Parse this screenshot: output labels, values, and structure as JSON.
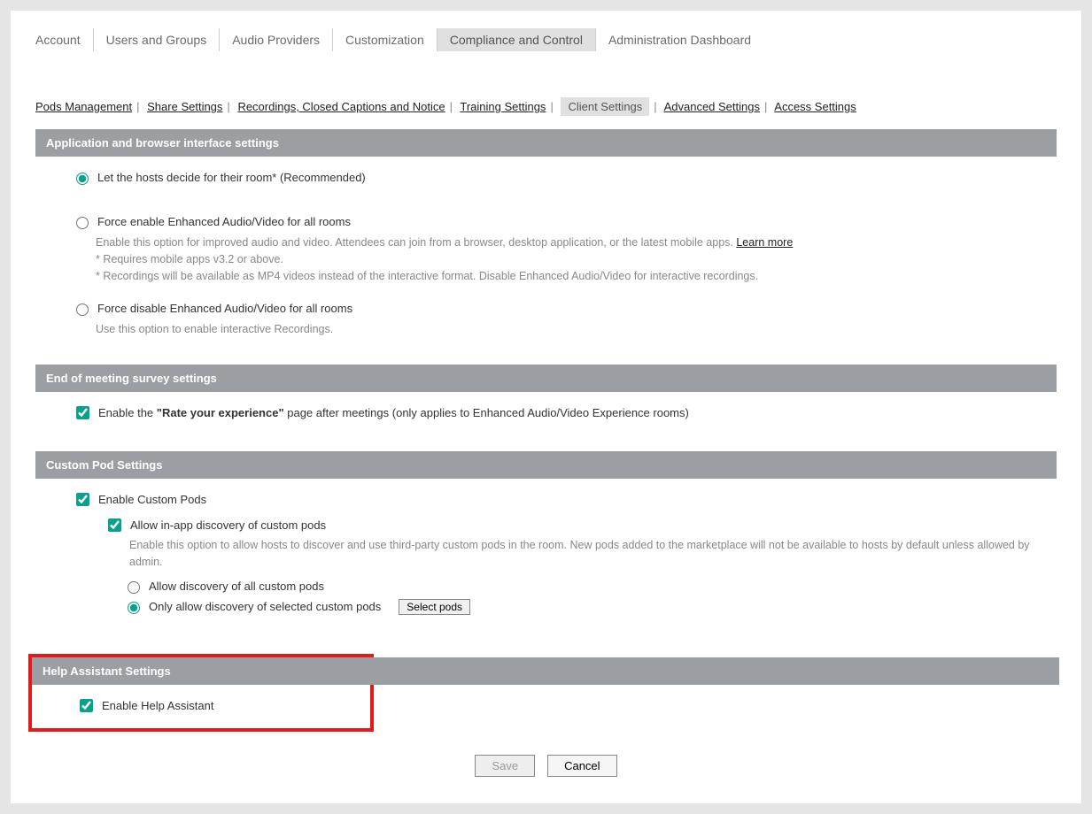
{
  "topNav": {
    "account": "Account",
    "usersGroups": "Users and Groups",
    "audioProviders": "Audio Providers",
    "customization": "Customization",
    "compliance": "Compliance and Control",
    "adminDashboard": "Administration Dashboard"
  },
  "subNav": {
    "pods": "Pods Management",
    "share": "Share Settings",
    "recordings": "Recordings, Closed Captions and Notice",
    "training": "Training Settings",
    "client": "Client Settings",
    "advanced": "Advanced Settings",
    "access": "Access Settings"
  },
  "sections": {
    "app": {
      "header": "Application and browser interface settings",
      "opt1": "Let the hosts decide for their room* (Recommended)",
      "opt2": "Force enable Enhanced Audio/Video for all rooms",
      "opt2desc1": "Enable this option for improved audio and video. Attendees can join from a browser, desktop application, or the latest mobile apps. ",
      "learnMore": "Learn more",
      "opt2desc2": "* Requires mobile apps v3.2 or above.",
      "opt2desc3": "* Recordings will be available as MP4 videos instead of the interactive format. Disable Enhanced Audio/Video for interactive recordings.",
      "opt3": "Force disable Enhanced Audio/Video for all rooms",
      "opt3desc": "Use this option to enable interactive Recordings."
    },
    "survey": {
      "header": "End of meeting survey settings",
      "pre": "Enable the ",
      "bold": "\"Rate your experience\"",
      "post": " page after meetings (only applies to Enhanced Audio/Video Experience rooms)"
    },
    "customPod": {
      "header": "Custom Pod Settings",
      "enable": "Enable Custom Pods",
      "allowDiscovery": "Allow in-app discovery of custom pods",
      "desc": "Enable this option to allow hosts to discover and use third-party custom pods in the room. New pods added to the marketplace will not be available to hosts by default unless allowed by admin.",
      "optAll": "Allow discovery of all custom pods",
      "optSelected": "Only allow discovery of selected custom pods",
      "selectPods": "Select pods"
    },
    "help": {
      "header": "Help Assistant Settings",
      "enable": "Enable Help Assistant"
    }
  },
  "buttons": {
    "save": "Save",
    "cancel": "Cancel"
  }
}
